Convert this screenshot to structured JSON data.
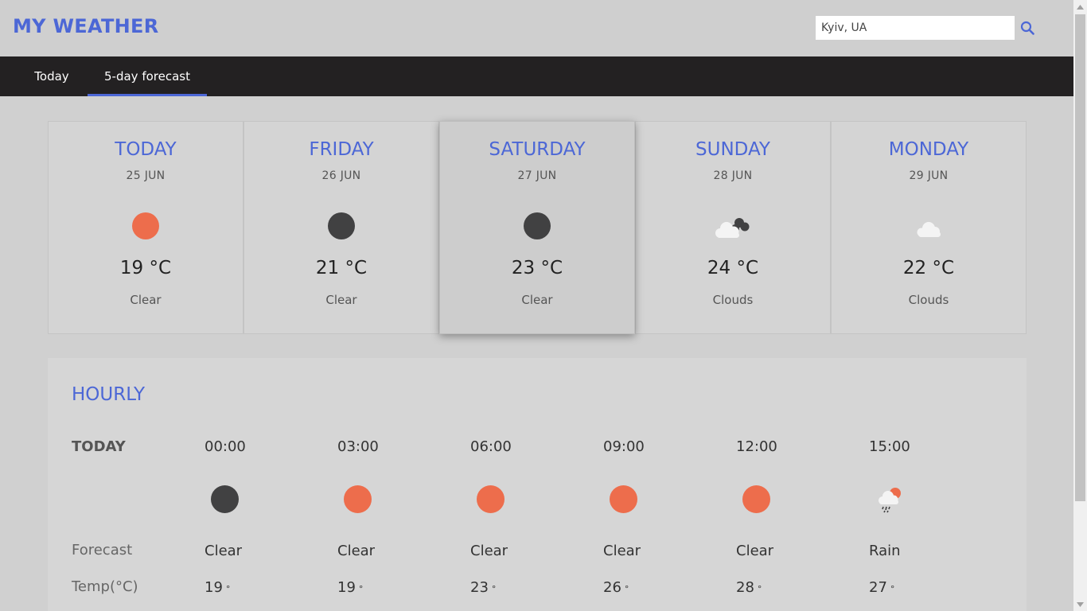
{
  "app": {
    "title": "MY WEATHER"
  },
  "search": {
    "value": "Kyiv, UA"
  },
  "tabs": [
    {
      "label": "Today"
    },
    {
      "label": "5-day forecast"
    }
  ],
  "days": [
    {
      "day": "TODAY",
      "date": "25 JUN",
      "temp": "19 °C",
      "desc": "Clear",
      "icon": "sun-icon"
    },
    {
      "day": "FRIDAY",
      "date": "26 JUN",
      "temp": "21 °C",
      "desc": "Clear",
      "icon": "moon-icon"
    },
    {
      "day": "SATURDAY",
      "date": "27 JUN",
      "temp": "23 °C",
      "desc": "Clear",
      "icon": "moon-icon"
    },
    {
      "day": "SUNDAY",
      "date": "28 JUN",
      "temp": "24 °C",
      "desc": "Clouds",
      "icon": "night-clouds-icon"
    },
    {
      "day": "MONDAY",
      "date": "29 JUN",
      "temp": "22 °C",
      "desc": "Clouds",
      "icon": "cloud-icon"
    }
  ],
  "hourly": {
    "title": "HOURLY",
    "row_labels": {
      "today": "TODAY",
      "forecast": "Forecast",
      "temp": "Temp(°C)"
    },
    "hours": [
      {
        "time": "00:00",
        "desc": "Clear",
        "temp": "19",
        "icon": "moon-icon"
      },
      {
        "time": "03:00",
        "desc": "Clear",
        "temp": "19",
        "icon": "sun-icon"
      },
      {
        "time": "06:00",
        "desc": "Clear",
        "temp": "23",
        "icon": "sun-icon"
      },
      {
        "time": "09:00",
        "desc": "Clear",
        "temp": "26",
        "icon": "sun-icon"
      },
      {
        "time": "12:00",
        "desc": "Clear",
        "temp": "28",
        "icon": "sun-icon"
      },
      {
        "time": "15:00",
        "desc": "Rain",
        "temp": "27",
        "icon": "rain-icon"
      }
    ],
    "degree_symbol": "°"
  },
  "colors": {
    "accent": "#4c67d6",
    "sun": "#ed6d4c",
    "moon": "#414142",
    "nav": "#232122"
  }
}
